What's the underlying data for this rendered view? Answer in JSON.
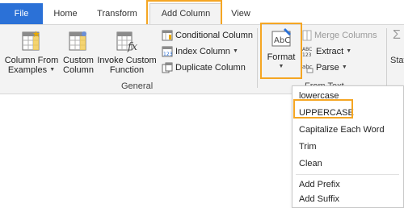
{
  "tabs": {
    "file": "File",
    "home": "Home",
    "transform": "Transform",
    "add_column": "Add Column",
    "view": "View"
  },
  "ribbon": {
    "column_from_examples": [
      "Column From",
      "Examples"
    ],
    "custom_column": [
      "Custom",
      "Column"
    ],
    "invoke_custom_function": [
      "Invoke Custom",
      "Function"
    ],
    "conditional_column": "Conditional Column",
    "index_column": "Index Column",
    "duplicate_column": "Duplicate Column",
    "format": "Format",
    "merge_columns": "Merge Columns",
    "extract": "Extract",
    "parse": "Parse",
    "group_general": "General",
    "partial_group_label": "From Text",
    "partial_right_label": "Stat",
    "partial_right_icon_char": "Σ"
  },
  "format_menu": {
    "items": [
      "lowercase",
      "UPPERCASE",
      "Capitalize Each Word",
      "Trim",
      "Clean",
      "Add Prefix",
      "Add Suffix"
    ]
  },
  "colors": {
    "file_tab": "#2b71d7",
    "highlight": "#f5a623",
    "ribbon_bg": "#f3f3f3"
  }
}
